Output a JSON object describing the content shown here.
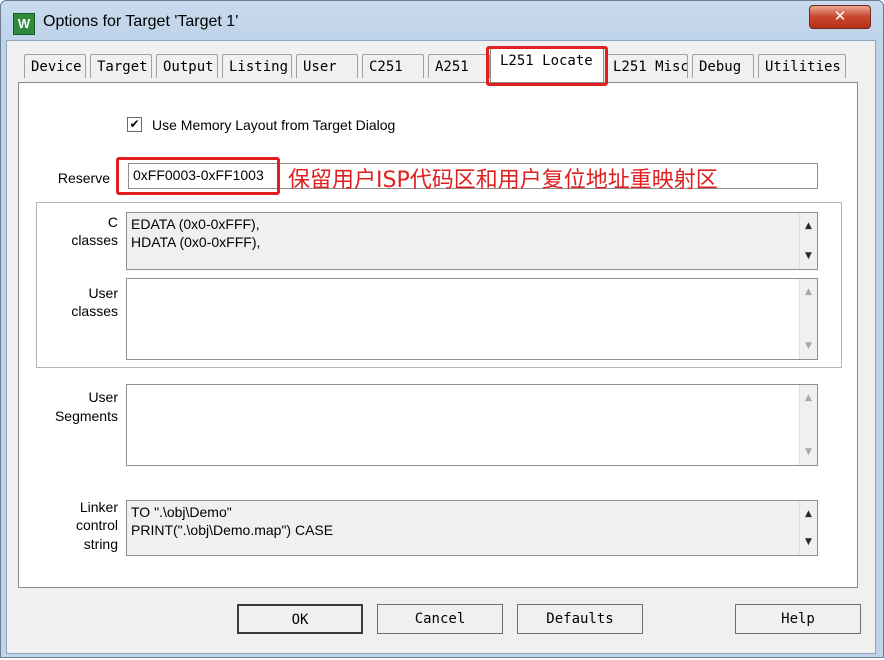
{
  "window": {
    "title": "Options for Target 'Target 1'",
    "app_icon": "keil-uvision-icon",
    "close_glyph": "✕"
  },
  "tabs": [
    {
      "label": "Device"
    },
    {
      "label": "Target"
    },
    {
      "label": "Output"
    },
    {
      "label": "Listing"
    },
    {
      "label": "User"
    },
    {
      "label": "C251"
    },
    {
      "label": "A251"
    },
    {
      "label": "L251 Locate"
    },
    {
      "label": "L251 Misc"
    },
    {
      "label": "Debug"
    },
    {
      "label": "Utilities"
    }
  ],
  "active_tab": "L251 Locate",
  "use_memory_layout": {
    "label": "Use Memory Layout from Target Dialog",
    "checked": true,
    "mark": "✔"
  },
  "reserve": {
    "label": "Reserve",
    "value": "0xFF0003-0xFF1003"
  },
  "annotation": "保留用户ISP代码区和用户复位地址重映射区",
  "c_classes": {
    "label_1": "C",
    "label_2": "classes",
    "line_1": "EDATA (0x0-0xFFF),",
    "line_2": "HDATA (0x0-0xFFF),"
  },
  "user_classes": {
    "label_1": "User",
    "label_2": "classes",
    "value": ""
  },
  "user_segments": {
    "label_1": "User",
    "label_2": "Segments",
    "value": ""
  },
  "linker_control": {
    "label_1": "Linker",
    "label_2": "control",
    "label_3": "string",
    "line_1": "TO \".\\obj\\Demo\"",
    "line_2": "PRINT(\".\\obj\\Demo.map\") CASE"
  },
  "scroll_arrows": {
    "up": "▲",
    "down": "▼"
  },
  "buttons": {
    "ok": "OK",
    "cancel": "Cancel",
    "defaults": "Defaults",
    "help": "Help"
  },
  "colors": {
    "annotation_red": "#e02020",
    "title_bar": "#bfd3ea",
    "dialog_bg": "#f0f0f0"
  }
}
